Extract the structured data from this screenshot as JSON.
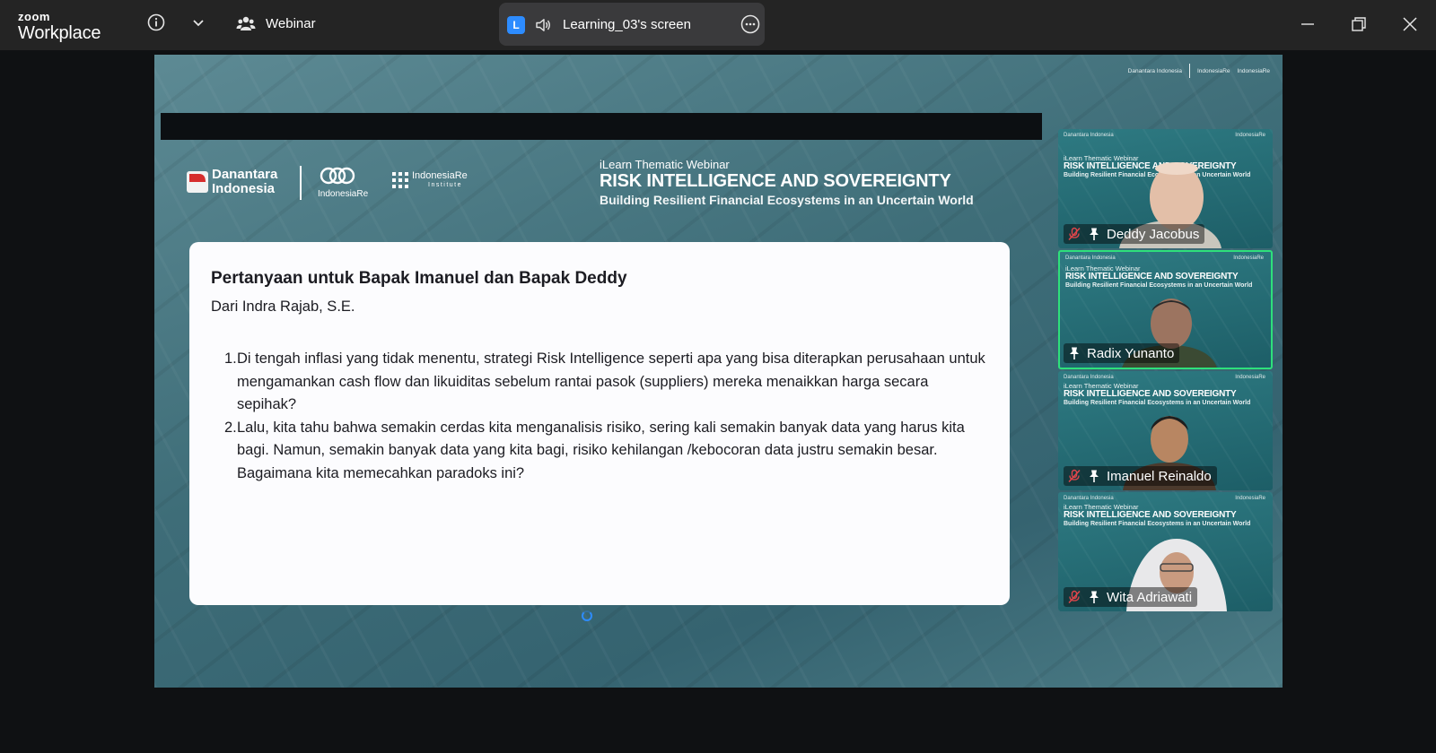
{
  "titlebar": {
    "app_brand_line1": "zoom",
    "app_brand_line2": "Workplace",
    "meeting_type": "Webinar",
    "share_badge": "L",
    "share_label": "Learning_03's screen",
    "icons": [
      "info-icon",
      "chevron-down-icon",
      "people-icon",
      "speaker-icon",
      "more-icon",
      "minimize-icon",
      "restore-icon",
      "close-icon"
    ]
  },
  "stage": {
    "corner_logo_1": "Danantara Indonesia",
    "corner_logo_2": "IndonesiaRe",
    "corner_logo_3": "IndonesiaRe"
  },
  "slide": {
    "logo_danantara": "Danantara Indonesia",
    "logo_indonesiare": "IndonesiaRe",
    "logo_institute": "IndonesiaRe",
    "logo_institute_sub": "Institute",
    "webinar_subtitle": "iLearn Thematic Webinar",
    "webinar_title": "RISK INTELLIGENCE AND SOVEREIGNTY",
    "webinar_tagline": "Building Resilient Financial Ecosystems in an Uncertain World",
    "card_title": "Pertanyaan untuk Bapak Imanuel dan Bapak Deddy",
    "card_from": "Dari Indra Rajab, S.E.",
    "questions": [
      {
        "num": "1.",
        "text": "Di tengah inflasi yang tidak menentu, strategi Risk Intelligence seperti apa yang bisa diterapkan perusahaan untuk mengamankan cash flow dan likuiditas sebelum rantai pasok (suppliers) mereka menaikkan harga secara sepihak?"
      },
      {
        "num": "2.",
        "text": "Lalu, kita tahu bahwa semakin cerdas kita menganalisis risiko, sering kali semakin banyak data yang harus kita bagi. Namun, semakin banyak data yang kita bagi, risiko kehilangan /kebocoran data justru semakin besar. Bagaimana kita memecahkan paradoks ini?"
      }
    ]
  },
  "tiles": {
    "mini_brand": "Danantara Indonesia",
    "mini_brand_r": "IndonesiaRe",
    "line1": "iLearn Thematic Webinar",
    "line2": "RISK INTELLIGENCE AND SOVEREIGNTY",
    "line3": "Building Resilient Financial Ecosystems in an Uncertain World",
    "participants": [
      {
        "name": "Deddy Jacobus",
        "muted": true,
        "active": false
      },
      {
        "name": "Radix Yunanto",
        "muted": false,
        "active": true
      },
      {
        "name": "Imanuel Reinaldo",
        "muted": true,
        "active": false
      },
      {
        "name": "Wita Adriawati",
        "muted": true,
        "active": false
      }
    ]
  },
  "colors": {
    "titlebar": "#242424",
    "accent": "#2d8cff",
    "active_speaker": "#2ee07b",
    "mute": "#e0464b"
  }
}
